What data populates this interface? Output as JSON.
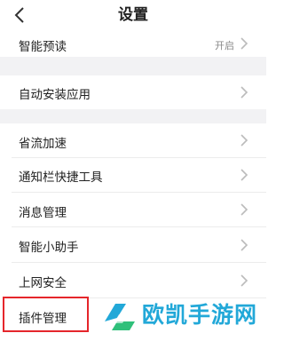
{
  "header": {
    "title": "设置"
  },
  "settings": [
    {
      "label": "智能预读",
      "value": "开启"
    },
    {
      "label": "自动安装应用"
    },
    {
      "label": "省流加速"
    },
    {
      "label": "通知栏快捷工具"
    },
    {
      "label": "消息管理"
    },
    {
      "label": "智能小助手"
    },
    {
      "label": "上网安全"
    },
    {
      "label": "插件管理"
    }
  ],
  "watermark": {
    "text": "欧凯手游网",
    "color": "#22a8d8"
  },
  "colors": {
    "highlight_border": "#e5262b",
    "separator": "#f2f2f4",
    "chevron": "#bbbbbb"
  }
}
